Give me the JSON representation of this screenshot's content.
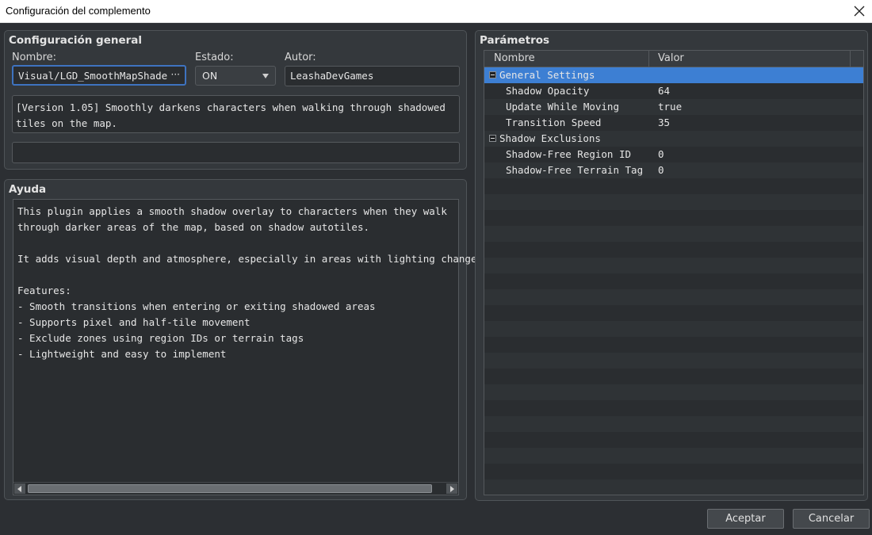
{
  "window": {
    "title": "Configuración del complemento",
    "close_icon": "close-icon"
  },
  "general": {
    "title": "Configuración general",
    "name_label": "Nombre:",
    "name_value": "Visual/LGD_SmoothMapShade",
    "name_browse": "···",
    "state_label": "Estado:",
    "state_value": "ON",
    "author_label": "Autor:",
    "author_value": "LeashaDevGames",
    "description": "[Version 1.05] Smoothly darkens characters when walking through shadowed tiles on the map.",
    "extra_value": ""
  },
  "help": {
    "title": "Ayuda",
    "text": "This plugin applies a smooth shadow overlay to characters when they walk\nthrough darker areas of the map, based on shadow autotiles.\n\nIt adds visual depth and atmosphere, especially in areas with lighting changes.\n\nFeatures:\n- Smooth transitions when entering or exiting shadowed areas\n- Supports pixel and half-tile movement\n- Exclude zones using region IDs or terrain tags\n- Lightweight and easy to implement"
  },
  "params": {
    "title": "Parámetros",
    "columns": [
      "Nombre",
      "Valor"
    ],
    "rows": [
      {
        "name": "General Settings",
        "value": "",
        "group": true,
        "selected": true
      },
      {
        "name": "Shadow Opacity",
        "value": "64",
        "group": false
      },
      {
        "name": "Update While Moving",
        "value": "true",
        "group": false
      },
      {
        "name": "Transition Speed",
        "value": "35",
        "group": false
      },
      {
        "name": "Shadow Exclusions",
        "value": "",
        "group": true
      },
      {
        "name": "Shadow-Free Region ID",
        "value": "0",
        "group": false
      },
      {
        "name": "Shadow-Free Terrain Tag",
        "value": "0",
        "group": false
      }
    ]
  },
  "buttons": {
    "ok": "Aceptar",
    "cancel": "Cancelar"
  },
  "colors": {
    "accent": "#3d7fd3",
    "focus_border": "#3e73c0",
    "background": "#2c2f33"
  }
}
